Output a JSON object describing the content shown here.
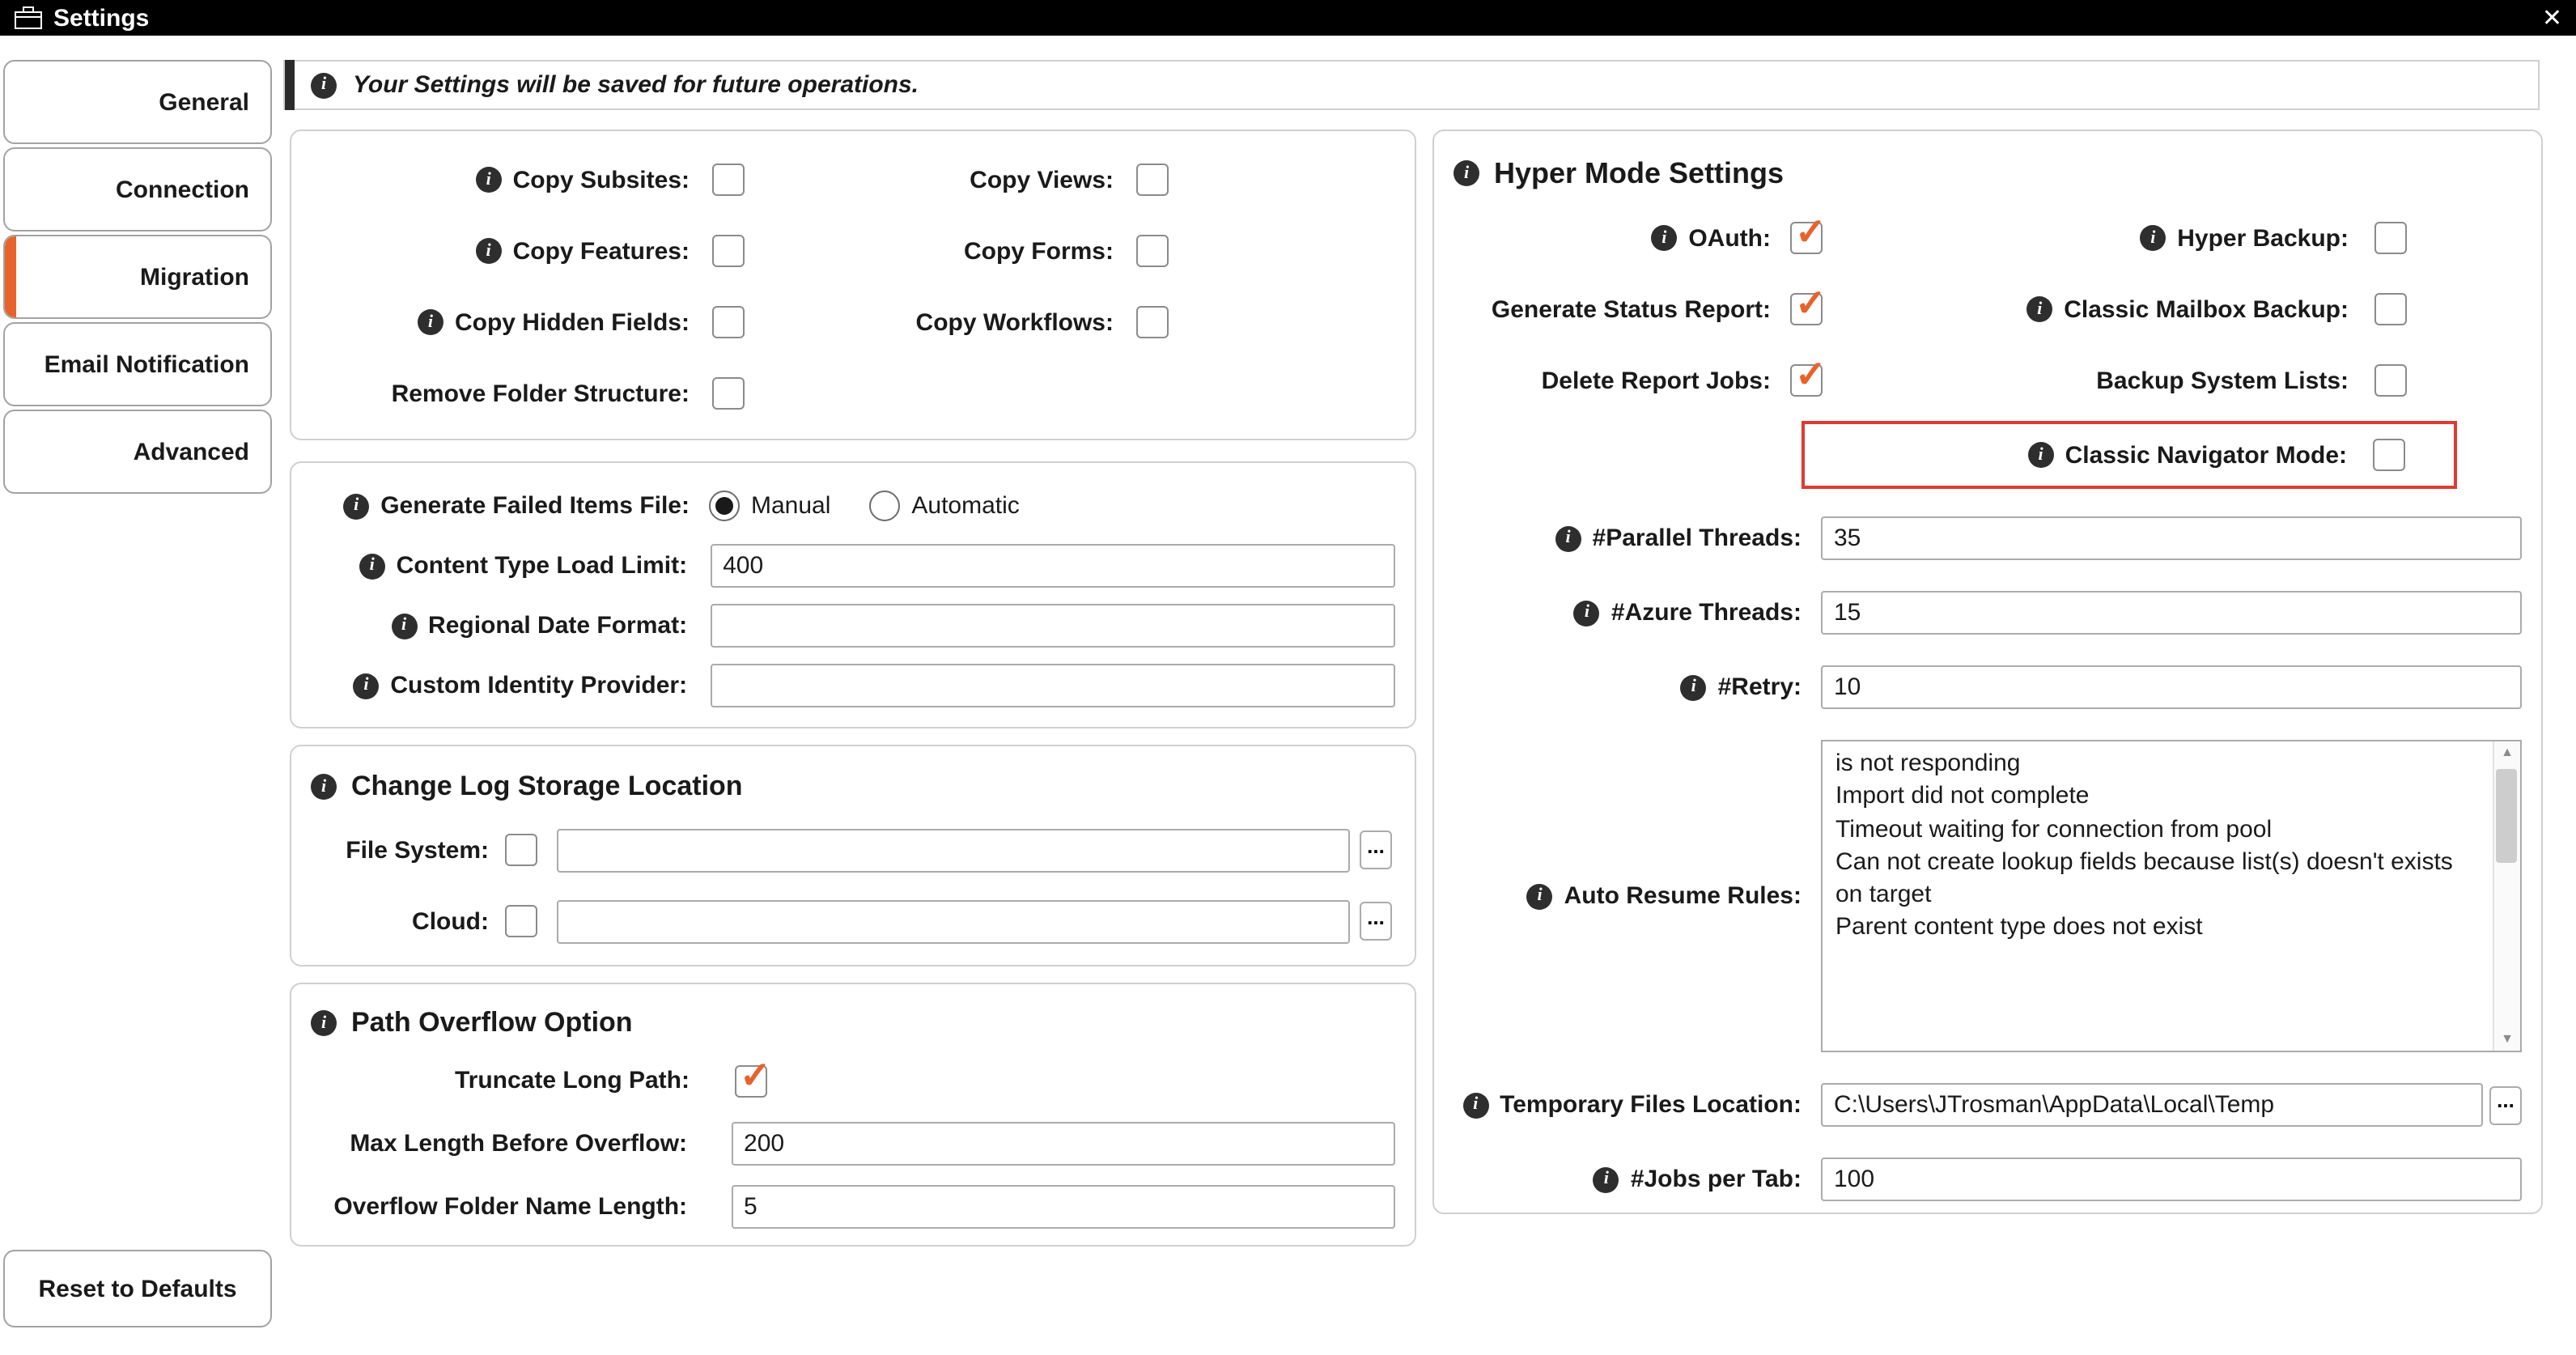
{
  "colors": {
    "accent": "#E8632C",
    "highlight_red": "#DF3A32",
    "titlebar": "#000000"
  },
  "icons": {
    "info": "i",
    "check": "✓",
    "close": "✕",
    "scroll_up": "▲",
    "scroll_down": "▼"
  },
  "titlebar": {
    "title": "Settings"
  },
  "sidebar": {
    "tabs": [
      {
        "label": "General",
        "active": false
      },
      {
        "label": "Connection",
        "active": false
      },
      {
        "label": "Migration",
        "active": true
      },
      {
        "label": "Email Notification",
        "active": false
      },
      {
        "label": "Advanced",
        "active": false
      }
    ],
    "reset_label": "Reset to Defaults"
  },
  "banner": {
    "text": "Your Settings will be saved for future operations."
  },
  "options_box": {
    "col1": [
      {
        "label": "Copy Subsites:",
        "info": true,
        "checked": false
      },
      {
        "label": "Copy Features:",
        "info": true,
        "checked": false
      },
      {
        "label": "Copy Hidden Fields:",
        "info": true,
        "checked": false
      },
      {
        "label": "Remove Folder Structure:",
        "info": false,
        "checked": false
      }
    ],
    "col2": [
      {
        "label": "Copy Views:",
        "checked": false
      },
      {
        "label": "Copy Forms:",
        "checked": false
      },
      {
        "label": "Copy Workflows:",
        "checked": false
      }
    ]
  },
  "failed_items_box": {
    "generate_label": "Generate Failed Items File:",
    "manual_label": "Manual",
    "manual_selected": true,
    "automatic_label": "Automatic",
    "automatic_selected": false,
    "content_type_load_limit_label": "Content Type Load Limit:",
    "content_type_load_limit_value": "400",
    "regional_date_format_label": "Regional Date Format:",
    "regional_date_format_value": "",
    "custom_identity_provider_label": "Custom Identity Provider:",
    "custom_identity_provider_value": ""
  },
  "change_log_box": {
    "title": "Change Log Storage Location",
    "file_system_label": "File System:",
    "file_system_checked": false,
    "file_system_value": "",
    "cloud_label": "Cloud:",
    "cloud_checked": false,
    "cloud_value": "",
    "browse_label": "..."
  },
  "path_overflow_box": {
    "title": "Path Overflow Option",
    "truncate_label": "Truncate Long Path:",
    "truncate_checked": true,
    "max_length_label": "Max Length Before Overflow:",
    "max_length_value": "200",
    "overflow_folder_label": "Overflow Folder Name Length:",
    "overflow_folder_value": "5"
  },
  "hyper_mode": {
    "title": "Hyper Mode Settings",
    "oauth_label": "OAuth:",
    "oauth_checked": true,
    "hyper_backup_label": "Hyper Backup:",
    "hyper_backup_checked": false,
    "generate_status_report_label": "Generate Status Report:",
    "generate_status_report_checked": true,
    "classic_mailbox_backup_label": "Classic Mailbox Backup:",
    "classic_mailbox_backup_checked": false,
    "delete_report_jobs_label": "Delete Report Jobs:",
    "delete_report_jobs_checked": true,
    "backup_system_lists_label": "Backup System Lists:",
    "backup_system_lists_checked": false,
    "classic_navigator_label": "Classic Navigator Mode:",
    "classic_navigator_checked": false,
    "parallel_threads_label": "#Parallel Threads:",
    "parallel_threads_value": "35",
    "azure_threads_label": "#Azure Threads:",
    "azure_threads_value": "15",
    "retry_label": "#Retry:",
    "retry_value": "10",
    "auto_resume_label": "Auto Resume Rules:",
    "auto_resume_value": "is not responding\nImport did not complete\nTimeout waiting for connection from pool\nCan not create lookup fields because list(s) doesn't exists on target\nParent content type does not exist",
    "temp_files_label": "Temporary Files Location:",
    "temp_files_value": "C:\\Users\\JTrosman\\AppData\\Local\\Temp",
    "browse_label": "...",
    "jobs_per_tab_label": "#Jobs per Tab:",
    "jobs_per_tab_value": "100"
  }
}
